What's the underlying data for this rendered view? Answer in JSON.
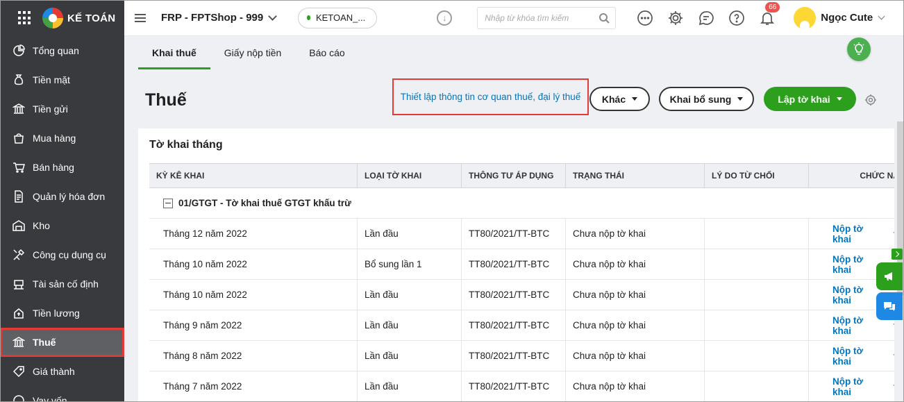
{
  "brand": {
    "name": "KẾ TOÁN"
  },
  "sidebar": {
    "items": [
      {
        "label": "Tổng quan",
        "icon": "dashboard-icon"
      },
      {
        "label": "Tiền mặt",
        "icon": "money-bag-icon"
      },
      {
        "label": "Tiền gửi",
        "icon": "bank-icon"
      },
      {
        "label": "Mua hàng",
        "icon": "shopping-bag-icon"
      },
      {
        "label": "Bán hàng",
        "icon": "cart-icon"
      },
      {
        "label": "Quản lý hóa đơn",
        "icon": "invoice-icon"
      },
      {
        "label": "Kho",
        "icon": "warehouse-icon"
      },
      {
        "label": "Công cụ dụng cụ",
        "icon": "tools-icon"
      },
      {
        "label": "Tài sản cố định",
        "icon": "asset-icon"
      },
      {
        "label": "Tiền lương",
        "icon": "salary-icon"
      },
      {
        "label": "Thuế",
        "icon": "tax-building-icon",
        "active": true
      },
      {
        "label": "Giá thành",
        "icon": "price-tag-icon"
      },
      {
        "label": "Vay vốn",
        "icon": "loan-icon"
      }
    ]
  },
  "topbar": {
    "org": "FRP - FPTShop - 999",
    "db_pill": "KETOAN_...",
    "search_placeholder": "Nhập từ khóa tìm kiếm",
    "notification_count": "66",
    "user_name": "Ngọc Cute"
  },
  "tabs": [
    {
      "label": "Khai thuế",
      "active": true
    },
    {
      "label": "Giấy nộp tiền"
    },
    {
      "label": "Báo cáo"
    }
  ],
  "page": {
    "title": "Thuế",
    "setup_link": "Thiết lập thông tin cơ quan thuế, đại lý thuế",
    "btn_other": "Khác",
    "btn_supplement": "Khai bổ sung",
    "btn_create": "Lập tờ khai"
  },
  "card": {
    "title": "Tờ khai tháng",
    "columns": [
      "KỲ KÊ KHAI",
      "LOẠI TỜ KHAI",
      "THÔNG TƯ ÁP DỤNG",
      "TRẠNG THÁI",
      "LÝ DO TỪ CHỐI",
      "CHỨC NĂ"
    ],
    "group": "01/GTGT - Tờ khai thuế GTGT khấu trừ",
    "rows": [
      {
        "period": "Tháng 12 năm 2022",
        "type": "Lần đầu",
        "circular": "TT80/2021/TT-BTC",
        "status": "Chưa nộp tờ khai",
        "reason": "",
        "action": "Nộp tờ khai"
      },
      {
        "period": "Tháng 10 năm 2022",
        "type": "Bổ sung lần 1",
        "circular": "TT80/2021/TT-BTC",
        "status": "Chưa nộp tờ khai",
        "reason": "",
        "action": "Nộp tờ khai"
      },
      {
        "period": "Tháng 10 năm 2022",
        "type": "Lần đầu",
        "circular": "TT80/2021/TT-BTC",
        "status": "Chưa nộp tờ khai",
        "reason": "",
        "action": "Nộp tờ khai"
      },
      {
        "period": "Tháng 9 năm 2022",
        "type": "Lần đầu",
        "circular": "TT80/2021/TT-BTC",
        "status": "Chưa nộp tờ khai",
        "reason": "",
        "action": "Nộp tờ khai"
      },
      {
        "period": "Tháng 8 năm 2022",
        "type": "Lần đầu",
        "circular": "TT80/2021/TT-BTC",
        "status": "Chưa nộp tờ khai",
        "reason": "",
        "action": "Nộp tờ khai"
      },
      {
        "period": "Tháng 7 năm 2022",
        "type": "Lần đầu",
        "circular": "TT80/2021/TT-BTC",
        "status": "Chưa nộp tờ khai",
        "reason": "",
        "action": "Nộp tờ khai"
      }
    ]
  },
  "colors": {
    "sidebar_bg": "#393a3d",
    "accent_green": "#2ca01c",
    "link_blue": "#0075c0",
    "highlight_red": "#e53935"
  }
}
